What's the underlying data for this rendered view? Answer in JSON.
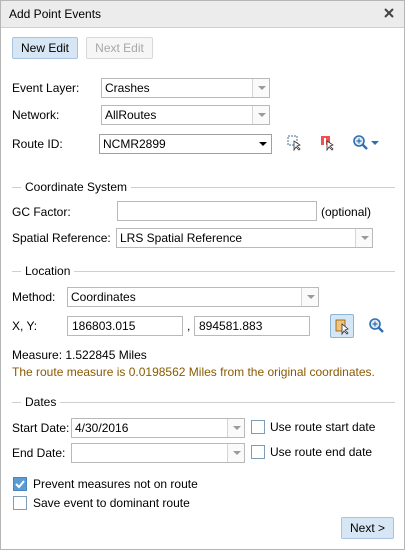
{
  "title": "Add Point Events",
  "toolbar": {
    "new_edit": "New Edit",
    "next_edit": "Next Edit"
  },
  "fields": {
    "event_layer_label": "Event Layer:",
    "event_layer_value": "Crashes",
    "network_label": "Network:",
    "network_value": "AllRoutes",
    "route_id_label": "Route ID:",
    "route_id_value": "NCMR2899"
  },
  "coordinate_system": {
    "title": "Coordinate System",
    "gc_factor_label": "GC Factor:",
    "gc_factor_value": "",
    "optional_label": "(optional)",
    "spatial_ref_label": "Spatial Reference:",
    "spatial_ref_value": "LRS Spatial Reference"
  },
  "location": {
    "title": "Location",
    "method_label": "Method:",
    "method_value": "Coordinates",
    "xy_label": "X, Y:",
    "x_value": "186803.015",
    "separator": ",",
    "y_value": "894581.883",
    "measure_text": "Measure: 1.522845 Miles",
    "note_text": "The route measure is 0.0198562 Miles from the original coordinates."
  },
  "dates": {
    "title": "Dates",
    "start_label": "Start Date:",
    "start_value": "4/30/2016",
    "use_start_label": "Use route start date",
    "end_label": "End Date:",
    "end_value": "",
    "use_end_label": "Use route end date"
  },
  "options": {
    "prevent_label": "Prevent measures not on route",
    "prevent_checked": true,
    "dominant_label": "Save event to dominant route",
    "dominant_checked": false
  },
  "footer": {
    "next_label": "Next >"
  },
  "colors": {
    "accent": "#d7e6f4",
    "note": "#8a5a00",
    "check": "#5b9bd5"
  }
}
